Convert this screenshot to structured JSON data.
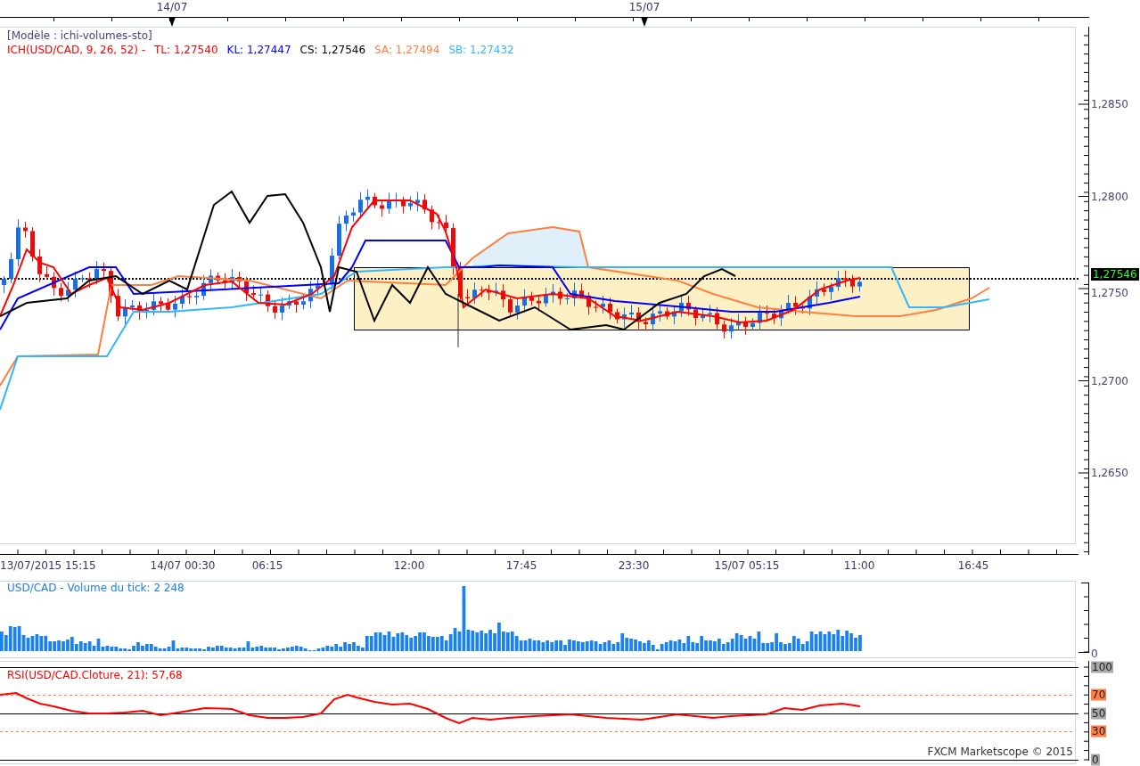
{
  "date_markers": [
    {
      "label": "14/07"
    },
    {
      "label": "15/07"
    }
  ],
  "main_panel": {
    "template": "[Modèle : ichi-volumes-sto]",
    "legend": [
      {
        "label": "ICH(USD/CAD, 9, 26, 52) -",
        "color": "#ff0000"
      },
      {
        "label": "TL: 1,27540",
        "color": "#ff0000"
      },
      {
        "label": "KL: 1,27447",
        "color": "#0000ff"
      },
      {
        "label": "CS: 1,27546",
        "color": "#000000"
      },
      {
        "label": "SA: 1,27494",
        "color": "#ff7f3f"
      },
      {
        "label": "SB: 1,27432",
        "color": "#33b5ff"
      }
    ],
    "price_axis": [
      "1,2850",
      "1,2800",
      "1,2750",
      "1,2700",
      "1,2650"
    ],
    "current_price": "1,27546"
  },
  "time_axis": [
    "13/07/2015 15:15",
    "14/07 00:30",
    "06:15",
    "12:00",
    "17:45",
    "23:30",
    "15/07 05:15",
    "11:00",
    "16:45"
  ],
  "volume_panel": {
    "title": "USD/CAD - Volume du tick: 2 248",
    "axis": [
      "0"
    ]
  },
  "rsi_panel": {
    "title": "RSI(USD/CAD.Cloture, 21): 57,68",
    "axis": [
      {
        "label": "100",
        "color": "#a8a8a8"
      },
      {
        "label": "70",
        "color": "#ff8040"
      },
      {
        "label": "50",
        "color": "#a8a8a8"
      },
      {
        "label": "30",
        "color": "#ff8040"
      },
      {
        "label": "0",
        "color": "#a8a8a8"
      }
    ]
  },
  "footer": "FXCM Marketscope © 2015"
}
